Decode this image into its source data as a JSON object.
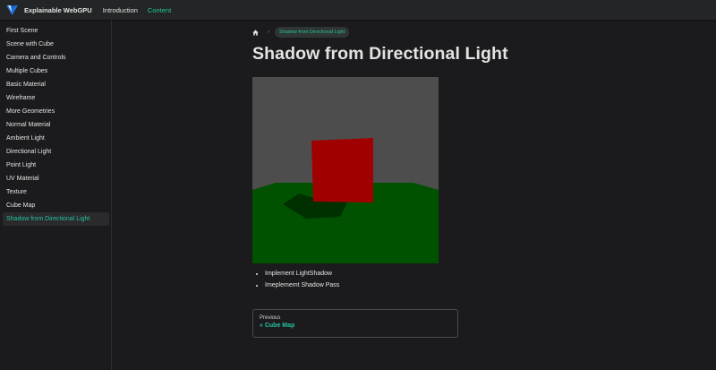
{
  "navbar": {
    "brand": "Explainable WebGPU",
    "links": [
      "Introduction",
      "Content"
    ],
    "logo_icon": "webgpu-logo",
    "colors": {
      "accent": "#25c2a0",
      "bg": "#242526"
    }
  },
  "sidebar": {
    "items": [
      "First Scene",
      "Scene with Cube",
      "Camera and Controls",
      "Multiple Cubes",
      "Basic Material",
      "Wireframe",
      "More Geometries",
      "Normal Material",
      "Ambient Light",
      "Directional Light",
      "Point Light",
      "UV Material",
      "Texture",
      "Cube Map",
      "Shadow from Directional Light"
    ],
    "active": "Shadow from Directional Light"
  },
  "breadcrumb": {
    "home_icon": "home-icon",
    "current": "Shadow from Directional Light"
  },
  "page": {
    "title": "Shadow from Directional Light",
    "bullets": [
      "Implement LightShadow",
      "Imeplememt Shadow Pass"
    ],
    "scene_colors": {
      "sky": "#4d4d4d",
      "ground": "#005200",
      "cube": "#a10000",
      "shadow": "#002a00"
    }
  },
  "pagination": {
    "sublabel": "Previous",
    "label": "« Cube Map"
  }
}
